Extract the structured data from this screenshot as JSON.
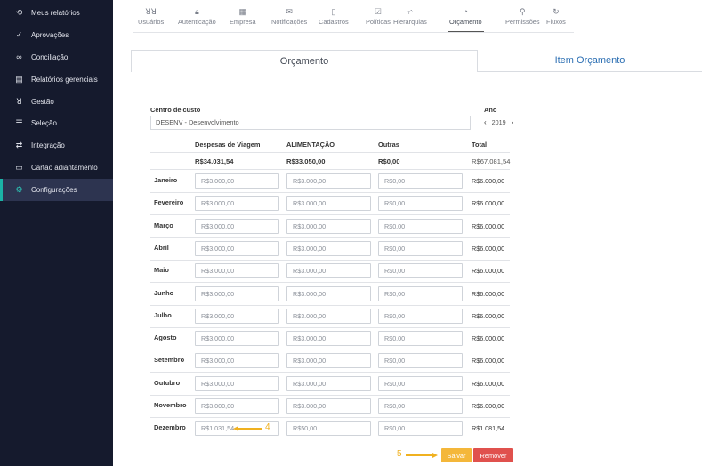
{
  "sidebar": {
    "items": [
      {
        "label": "Meus relatórios",
        "icon": "history-icon",
        "glyph": "⟲"
      },
      {
        "label": "Aprovações",
        "icon": "check-icon",
        "glyph": "✓"
      },
      {
        "label": "Conciliação",
        "icon": "link-icon",
        "glyph": "∞"
      },
      {
        "label": "Relatórios gerenciais",
        "icon": "report-icon",
        "glyph": "▤"
      },
      {
        "label": "Gestão",
        "icon": "users-icon",
        "glyph": "ꓤ"
      },
      {
        "label": "Seleção",
        "icon": "list-icon",
        "glyph": "☰"
      },
      {
        "label": "Integração",
        "icon": "sync-icon",
        "glyph": "⇄"
      },
      {
        "label": "Cartão adiantamento",
        "icon": "card-icon",
        "glyph": "▭"
      },
      {
        "label": "Configurações",
        "icon": "gear-icon",
        "glyph": "⚙"
      }
    ],
    "active_index": 8,
    "accent": "#1bb3a6"
  },
  "topnav": {
    "tabs": [
      {
        "label": "Usuários",
        "icon": "users-icon",
        "glyph": "ꓤꓤ"
      },
      {
        "label": "Autenticação",
        "icon": "lock-icon",
        "glyph": "🔒︎"
      },
      {
        "label": "Empresa",
        "icon": "building-icon",
        "glyph": "▦"
      },
      {
        "label": "Notificações",
        "icon": "mail-icon",
        "glyph": "✉"
      },
      {
        "label": "Cadastros",
        "icon": "file-icon",
        "glyph": "▯"
      },
      {
        "label": "Políticas",
        "icon": "checkbox-icon",
        "glyph": "☑"
      },
      {
        "label": "Hierarquias",
        "icon": "hierarchy-icon",
        "glyph": "⩫"
      },
      {
        "label": "Orçamento",
        "icon": "pie-icon",
        "glyph": "◔"
      },
      {
        "label": "Permissões",
        "icon": "key-icon",
        "glyph": "⚲"
      },
      {
        "label": "Fluxos",
        "icon": "refresh-icon",
        "glyph": "↻"
      }
    ],
    "active_index": 7
  },
  "page_tabs": {
    "orcamento": "Orçamento",
    "item_orcamento": "Item Orçamento"
  },
  "form": {
    "centro_label": "Centro de custo",
    "centro_value": "DESENV - Desenvolvimento",
    "ano_label": "Ano",
    "ano_value": "2019"
  },
  "table": {
    "headers": {
      "viagem": "Despesas de Viagem",
      "alimentacao": "ALIMENTAÇÃO",
      "outras": "Outras",
      "total": "Total"
    },
    "totals": {
      "viagem": "R$34.031,54",
      "alimentacao": "R$33.050,00",
      "outras": "R$0,00",
      "total": "R$67.081,54"
    },
    "rows": [
      {
        "month": "Janeiro",
        "viagem": "R$3.000,00",
        "alimentacao": "R$3.000,00",
        "outras": "R$0,00",
        "total": "R$6.000,00"
      },
      {
        "month": "Fevereiro",
        "viagem": "R$3.000,00",
        "alimentacao": "R$3.000,00",
        "outras": "R$0,00",
        "total": "R$6.000,00"
      },
      {
        "month": "Março",
        "viagem": "R$3.000,00",
        "alimentacao": "R$3.000,00",
        "outras": "R$0,00",
        "total": "R$6.000,00"
      },
      {
        "month": "Abril",
        "viagem": "R$3.000,00",
        "alimentacao": "R$3.000,00",
        "outras": "R$0,00",
        "total": "R$6.000,00"
      },
      {
        "month": "Maio",
        "viagem": "R$3.000,00",
        "alimentacao": "R$3.000,00",
        "outras": "R$0,00",
        "total": "R$6.000,00"
      },
      {
        "month": "Junho",
        "viagem": "R$3.000,00",
        "alimentacao": "R$3.000,00",
        "outras": "R$0,00",
        "total": "R$6.000,00"
      },
      {
        "month": "Julho",
        "viagem": "R$3.000,00",
        "alimentacao": "R$3.000,00",
        "outras": "R$0,00",
        "total": "R$6.000,00"
      },
      {
        "month": "Agosto",
        "viagem": "R$3.000,00",
        "alimentacao": "R$3.000,00",
        "outras": "R$0,00",
        "total": "R$6.000,00"
      },
      {
        "month": "Setembro",
        "viagem": "R$3.000,00",
        "alimentacao": "R$3.000,00",
        "outras": "R$0,00",
        "total": "R$6.000,00"
      },
      {
        "month": "Outubro",
        "viagem": "R$3.000,00",
        "alimentacao": "R$3.000,00",
        "outras": "R$0,00",
        "total": "R$6.000,00"
      },
      {
        "month": "Novembro",
        "viagem": "R$3.000,00",
        "alimentacao": "R$3.000,00",
        "outras": "R$0,00",
        "total": "R$6.000,00"
      },
      {
        "month": "Dezembro",
        "viagem": "R$1.031,54",
        "alimentacao": "R$50,00",
        "outras": "R$0,00",
        "total": "R$1.081,54"
      }
    ]
  },
  "annotations": {
    "step4": "4",
    "step5": "5",
    "color": "#f0b120"
  },
  "buttons": {
    "save": "Salvar",
    "remove": "Remover",
    "save_color": "#f4b73a",
    "remove_color": "#e0514d"
  }
}
